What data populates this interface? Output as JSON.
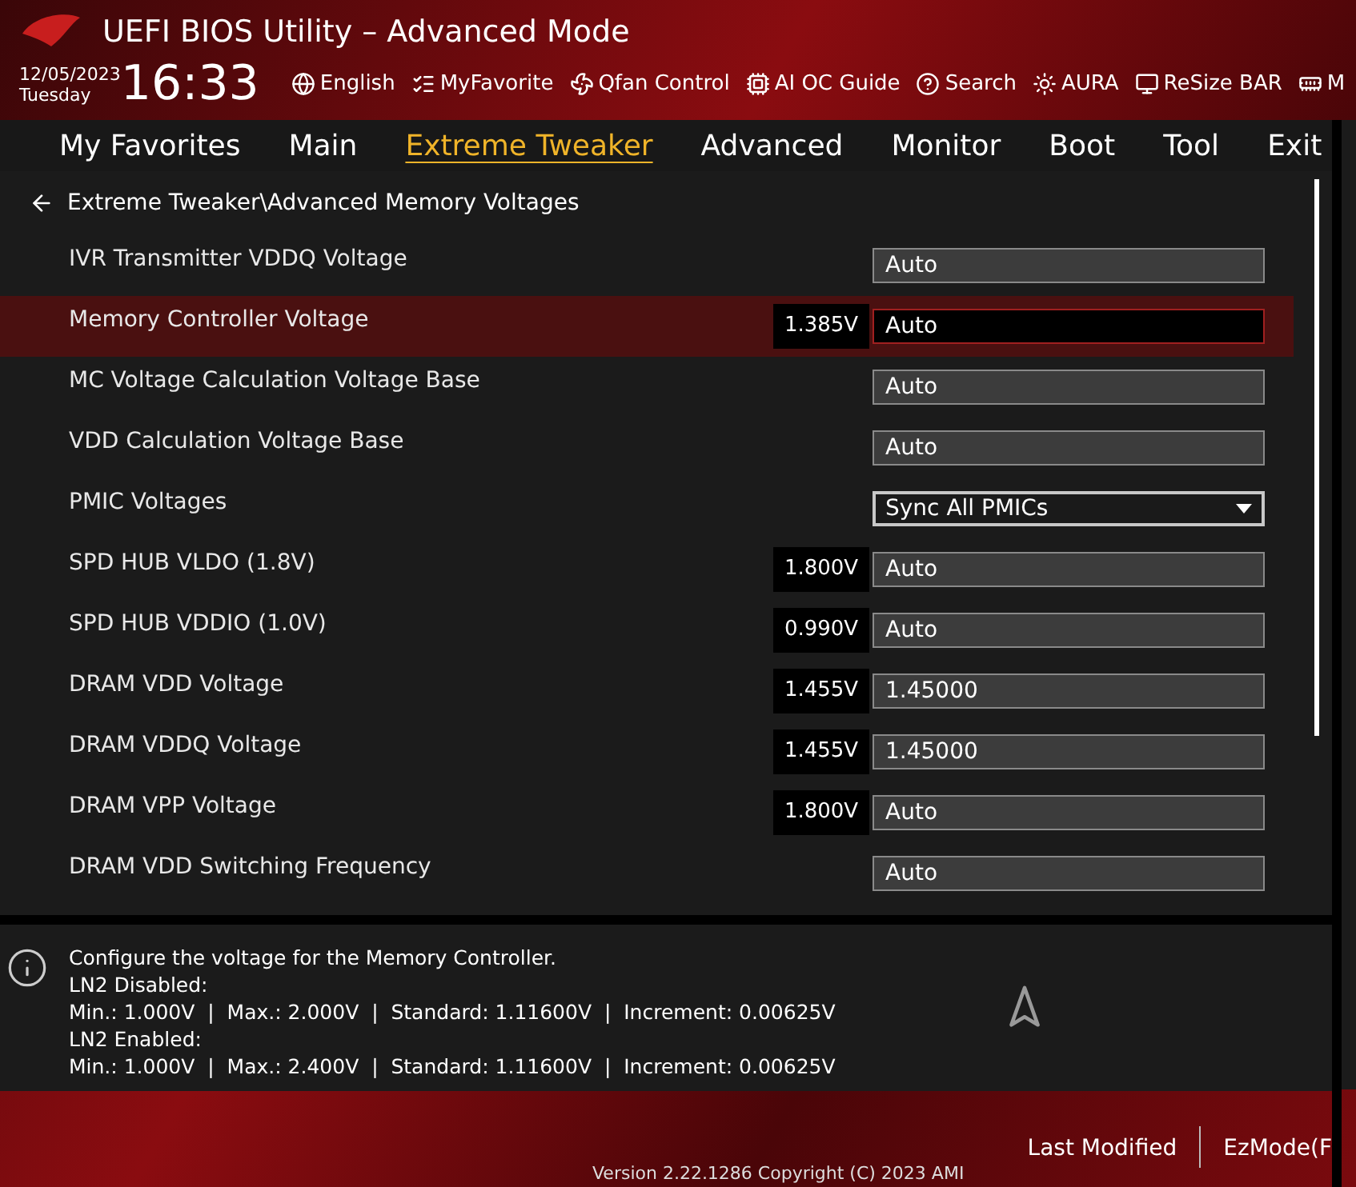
{
  "window": {
    "title": "UEFI BIOS Utility – Advanced Mode"
  },
  "datetime": {
    "date": "12/05/2023",
    "day": "Tuesday",
    "time": "16:33"
  },
  "toolbar": [
    {
      "label": "English",
      "kind": "globe"
    },
    {
      "label": "MyFavorite",
      "kind": "favorite"
    },
    {
      "label": "Qfan Control",
      "kind": "fan"
    },
    {
      "label": "AI OC Guide",
      "kind": "guide"
    },
    {
      "label": "Search",
      "kind": "search"
    },
    {
      "label": "AURA",
      "kind": "aura"
    },
    {
      "label": "ReSize BAR",
      "kind": "bar"
    },
    {
      "label": "M",
      "kind": "memtest"
    }
  ],
  "tabs": [
    {
      "label": "My Favorites",
      "selected": false
    },
    {
      "label": "Main",
      "selected": false
    },
    {
      "label": "Extreme Tweaker",
      "selected": true
    },
    {
      "label": "Advanced",
      "selected": false
    },
    {
      "label": "Monitor",
      "selected": false
    },
    {
      "label": "Boot",
      "selected": false
    },
    {
      "label": "Tool",
      "selected": false
    },
    {
      "label": "Exit",
      "selected": false
    }
  ],
  "breadcrumb": "Extreme Tweaker\\Advanced Memory Voltages",
  "settings": [
    {
      "label": "IVR Transmitter VDDQ Voltage",
      "value": "Auto",
      "kind": "field",
      "selected": false
    },
    {
      "label": "Memory Controller Voltage",
      "reading": "1.385V",
      "value": "Auto",
      "kind": "field",
      "selected": true
    },
    {
      "label": "MC Voltage Calculation Voltage Base",
      "value": "Auto",
      "kind": "field",
      "selected": false
    },
    {
      "label": "VDD Calculation Voltage Base",
      "value": "Auto",
      "kind": "field",
      "selected": false
    },
    {
      "label": "PMIC Voltages",
      "value": "Sync All PMICs",
      "kind": "dropdown",
      "selected": false
    },
    {
      "label": "SPD HUB VLDO (1.8V)",
      "reading": "1.800V",
      "value": "Auto",
      "kind": "field",
      "selected": false
    },
    {
      "label": "SPD HUB VDDIO (1.0V)",
      "reading": "0.990V",
      "value": "Auto",
      "kind": "field",
      "selected": false
    },
    {
      "label": "DRAM VDD Voltage",
      "reading": "1.455V",
      "value": "1.45000",
      "kind": "field",
      "selected": false
    },
    {
      "label": "DRAM VDDQ Voltage",
      "reading": "1.455V",
      "value": "1.45000",
      "kind": "field",
      "selected": false
    },
    {
      "label": "DRAM VPP Voltage",
      "reading": "1.800V",
      "value": "Auto",
      "kind": "field",
      "selected": false
    },
    {
      "label": "DRAM VDD Switching Frequency",
      "value": "Auto",
      "kind": "field",
      "selected": false
    }
  ],
  "help": {
    "lines": [
      "Configure the voltage for the Memory Controller.",
      "LN2 Disabled:",
      "Min.: 1.000V  |  Max.: 2.000V  |  Standard: 1.11600V  |  Increment: 0.00625V",
      "LN2 Enabled:",
      "Min.: 1.000V  |  Max.: 2.400V  |  Standard: 1.11600V  |  Increment: 0.00625V"
    ]
  },
  "footer": {
    "buttons": [
      "Last Modified",
      "EzMode(F"
    ],
    "version": "Version 2.22.1286 Copyright (C) 2023 AMI"
  }
}
